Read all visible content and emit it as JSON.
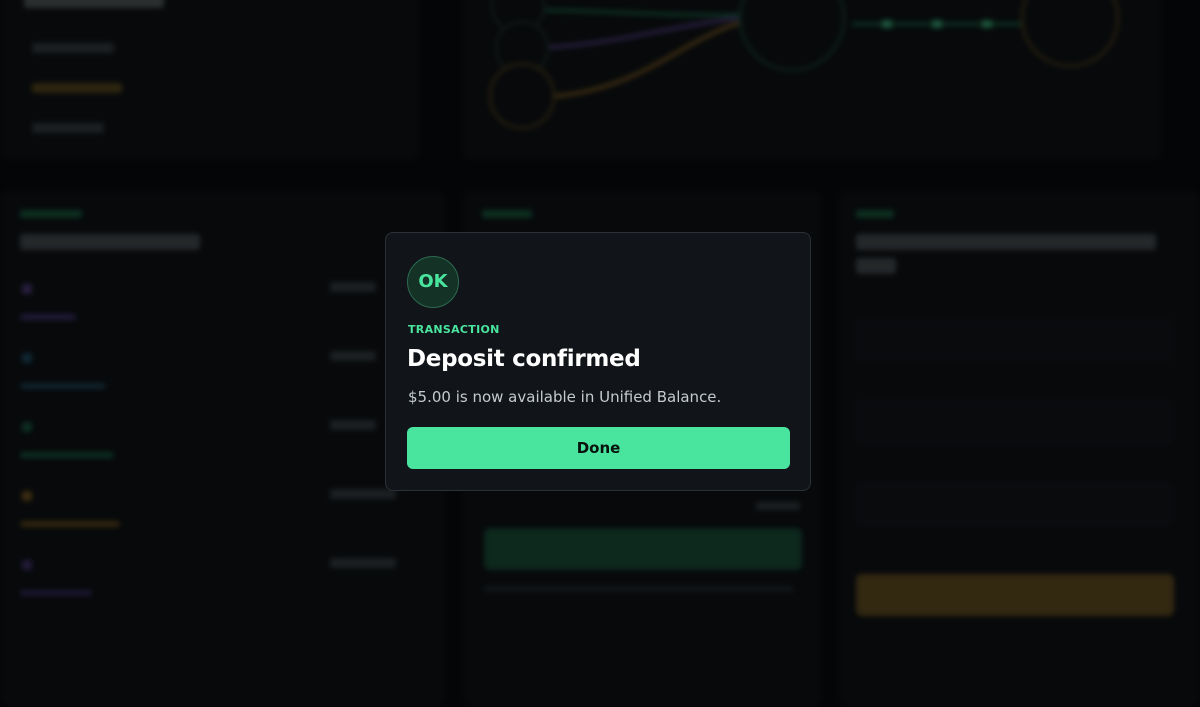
{
  "modal": {
    "badge": "OK",
    "label": "TRANSACTION",
    "title": "Deposit confirmed",
    "message": "$5.00 is now available in Unified Balance.",
    "done_label": "Done"
  },
  "colors": {
    "accent": "#49e59f",
    "modal_bg": "#111519",
    "page_bg": "#07090b"
  }
}
